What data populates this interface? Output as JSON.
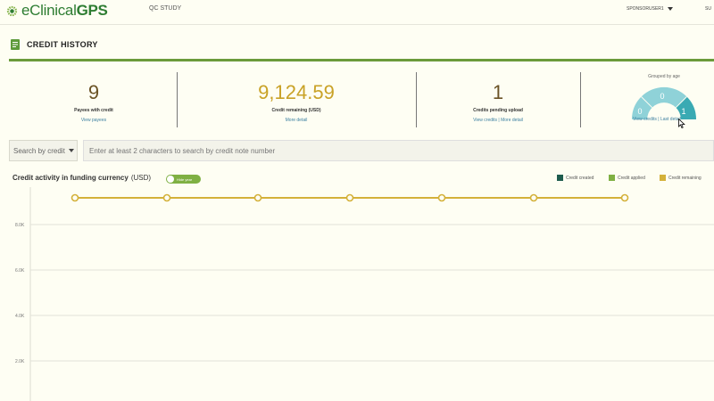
{
  "header": {
    "brand_light": "eClinical",
    "brand_bold": "GPS",
    "study": "QC STUDY",
    "user": "SPONSORUSER1",
    "extra": "SU"
  },
  "page": {
    "title": "CREDIT HISTORY"
  },
  "summary": {
    "payees": {
      "value": "9",
      "label": "Payees with credit",
      "link": "View payees"
    },
    "remaining": {
      "value": "9,124.59",
      "label": "Credit remaining (USD)",
      "link": "More detail"
    },
    "pending": {
      "value": "1",
      "label": "Credits pending upload",
      "link1": "View credits",
      "sep": "|",
      "link2": "More detail"
    },
    "age": {
      "caption": "Grouped by age",
      "segments": [
        "0",
        "0",
        "1"
      ],
      "link1": "View credits",
      "sep": "|",
      "link2": "Last detail"
    }
  },
  "search": {
    "dropdown": "Search by credit",
    "placeholder": "Enter at least 2 characters to search by credit note number"
  },
  "chart_section": {
    "title": "Credit activity in funding currency",
    "unit": "(USD)",
    "toggle_label": "Hide year",
    "legend": [
      {
        "label": "Credit created",
        "color": "#1e5c4e"
      },
      {
        "label": "Credit applied",
        "color": "#7fb043"
      },
      {
        "label": "Credit remaining",
        "color": "#d4b13a"
      }
    ]
  },
  "chart_data": {
    "type": "line",
    "x": [
      1,
      2,
      3,
      4,
      5,
      6,
      7
    ],
    "series": [
      {
        "name": "Credit remaining",
        "values": [
          9124.59,
          9124.59,
          9124.59,
          9124.59,
          9124.59,
          9124.59,
          9124.59
        ]
      }
    ],
    "y_ticks": [
      "8.0K",
      "6.0K",
      "4.0K",
      "2.0K"
    ],
    "y_tick_values": [
      8000,
      6000,
      4000,
      2000
    ],
    "grid": true
  },
  "colors": {
    "accent_green": "#6b9a3a",
    "value_gold": "#c9a227",
    "value_brown": "#6b5325",
    "gauge_teal_light": "#8fd2d8",
    "gauge_teal_dark": "#3aaab3",
    "link_blue": "#3b7fa0"
  },
  "icons": {
    "logo": "gear-logo-icon",
    "page": "document-icon",
    "cursor": "pointer-cursor-icon"
  }
}
